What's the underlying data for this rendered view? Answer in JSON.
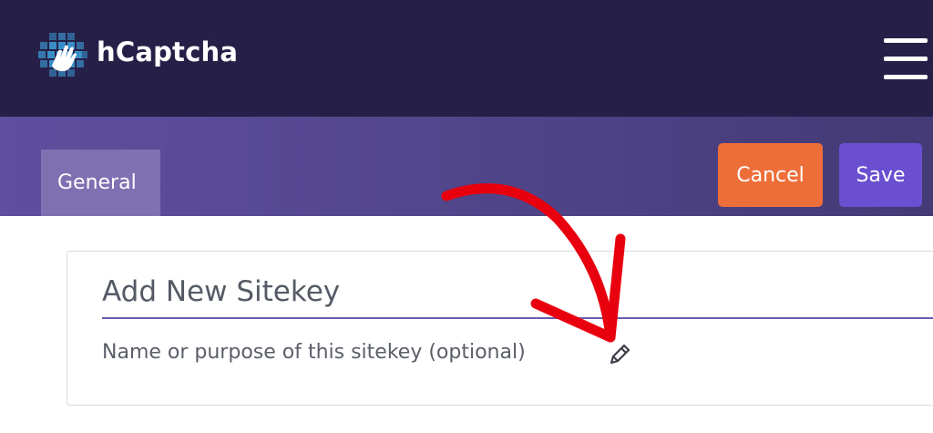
{
  "header": {
    "brand": "hCaptcha",
    "logo_icon": "hand-wave-logo-icon",
    "menu_icon": "hamburger-menu-icon"
  },
  "tabs": [
    {
      "label": "General",
      "active": true
    }
  ],
  "actions": {
    "cancel_label": "Cancel",
    "save_label": "Save"
  },
  "sitekey_form": {
    "title_placeholder": "Add New Sitekey",
    "description_text": "Name or purpose of this sitekey (optional)",
    "edit_icon": "pencil-icon"
  },
  "annotation": {
    "icon": "red-curved-arrow-icon"
  },
  "colors": {
    "header_bg": "#262048",
    "subheader_bg": "#54468e",
    "tab_active_bg": "#7f70b2",
    "cancel_bg": "#ee6e3a",
    "save_bg": "#6a4fd0",
    "input_underline": "#6a5bb0",
    "annotation_arrow": "#e8000e"
  }
}
